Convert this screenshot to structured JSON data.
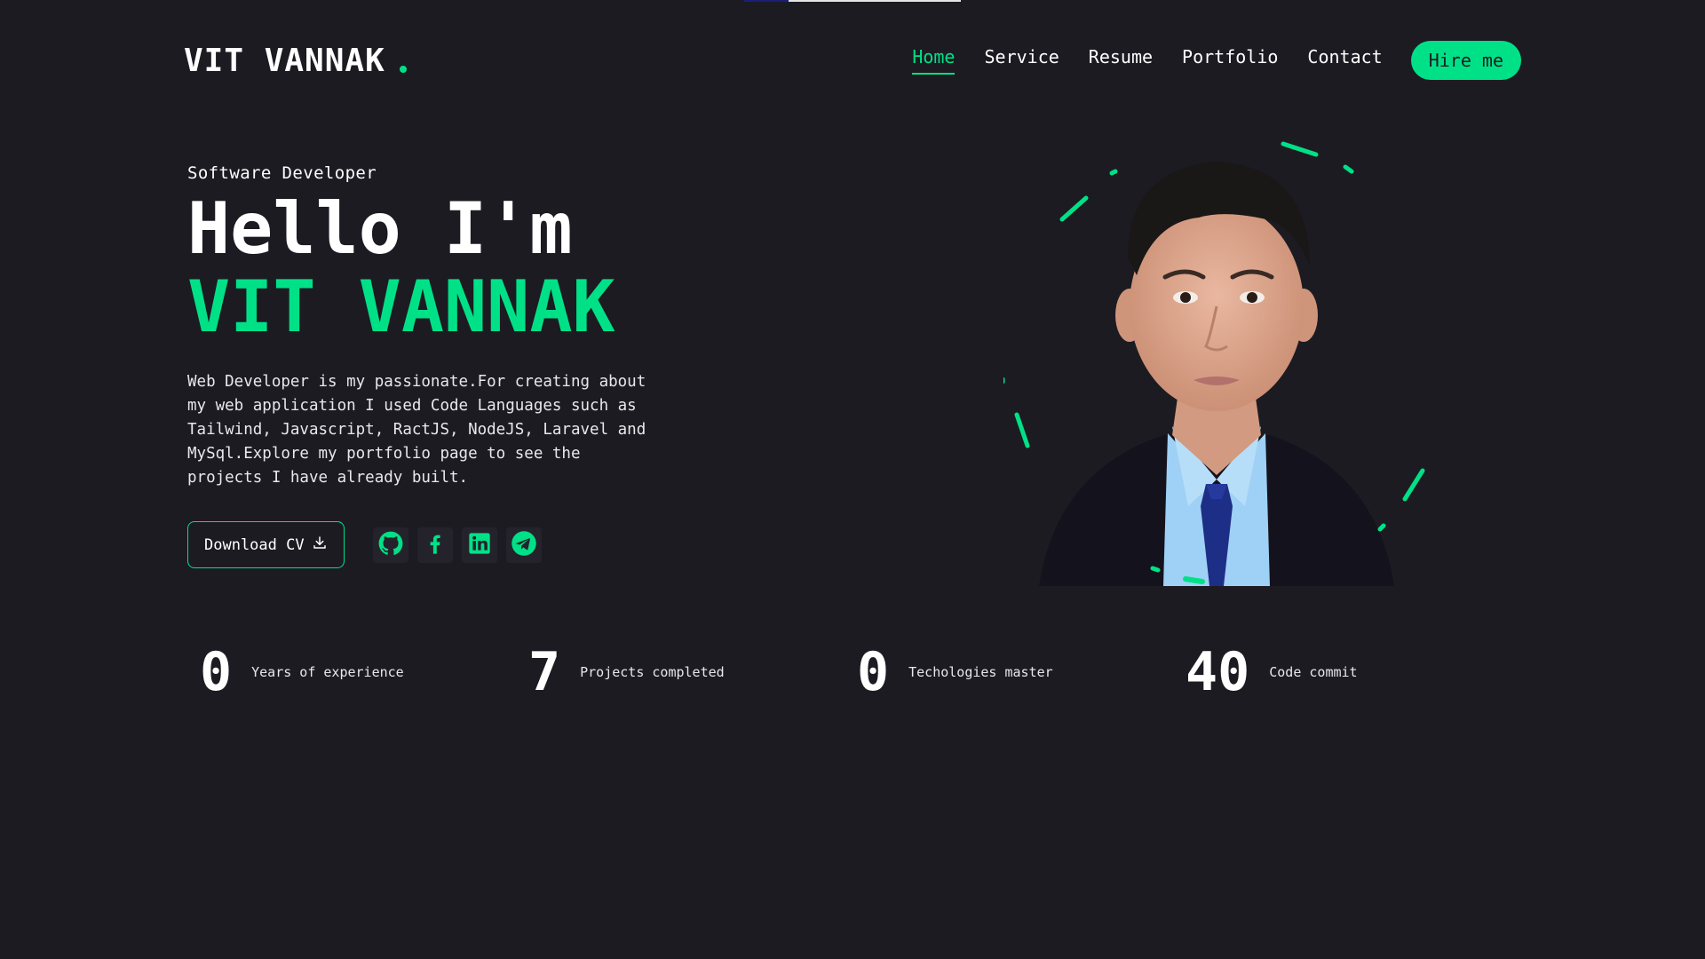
{
  "brand": {
    "name": "VIT VANNAK",
    "accent_color": "#00e187",
    "background_color": "#1c1b22"
  },
  "nav": {
    "items": [
      {
        "label": "Home",
        "active": true
      },
      {
        "label": "Service",
        "active": false
      },
      {
        "label": "Resume",
        "active": false
      },
      {
        "label": "Portfolio",
        "active": false
      },
      {
        "label": "Contact",
        "active": false
      }
    ],
    "cta_label": "Hire me"
  },
  "hero": {
    "role": "Software Developer",
    "greeting": "Hello I'm",
    "name": "VIT VANNAK",
    "description": "Web Developer is my passionate.For creating about my web application I used Code Languages such as Tailwind, Javascript, RactJS, NodeJS, Laravel and MySql.Explore my portfolio page to see the projects I have already built.",
    "download_label": "Download CV",
    "download_icon": "download-icon",
    "socials": [
      {
        "name": "github-icon"
      },
      {
        "name": "facebook-icon"
      },
      {
        "name": "linkedin-icon"
      },
      {
        "name": "telegram-icon"
      }
    ]
  },
  "stats": [
    {
      "value": "0",
      "label": "Years of experience"
    },
    {
      "value": "7",
      "label": "Projects completed"
    },
    {
      "value": "0",
      "label": "Techologies master"
    },
    {
      "value": "40",
      "label": "Code commit"
    }
  ]
}
